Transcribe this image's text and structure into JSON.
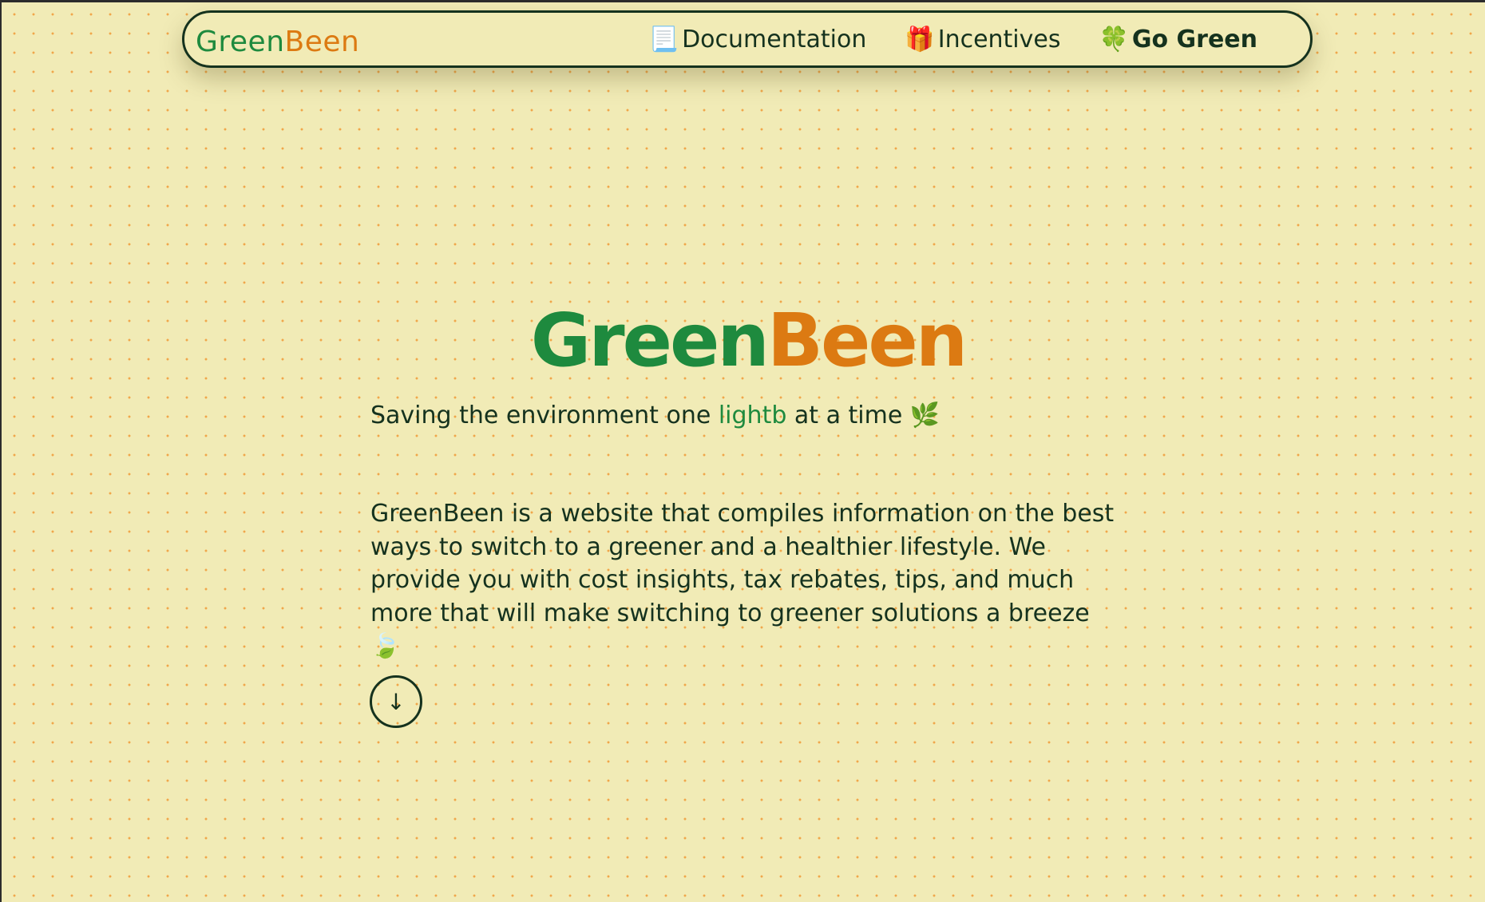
{
  "navbar": {
    "brand": {
      "part1": "Green",
      "part2": "Been"
    },
    "links": [
      {
        "icon": "📃",
        "icon_name": "documentation-icon",
        "label": "Documentation"
      },
      {
        "icon": "🎁",
        "icon_name": "gift-icon",
        "label": "Incentives"
      },
      {
        "icon": "🍀",
        "icon_name": "clover-icon",
        "label": "Go Green"
      }
    ]
  },
  "hero": {
    "title_part1": "Green",
    "title_part2": "Been",
    "tagline_before": "Saving the environment one ",
    "tagline_highlight": "lightb",
    "tagline_after": " at a time ",
    "tagline_emoji": "🌿",
    "description": "GreenBeen is a website that compiles information on the best ways to switch to a greener and a healthier lifestyle. We provide you with cost insights, tax rebates, tips, and much more that will make switching to greener solutions a breeze ",
    "description_emoji": "🍃",
    "scroll_arrow": "↓"
  },
  "colors": {
    "background": "#f1ebb6",
    "dots": "#f0a64a",
    "green": "#1e8a3e",
    "orange": "#dc7a12",
    "text": "#15321e"
  }
}
